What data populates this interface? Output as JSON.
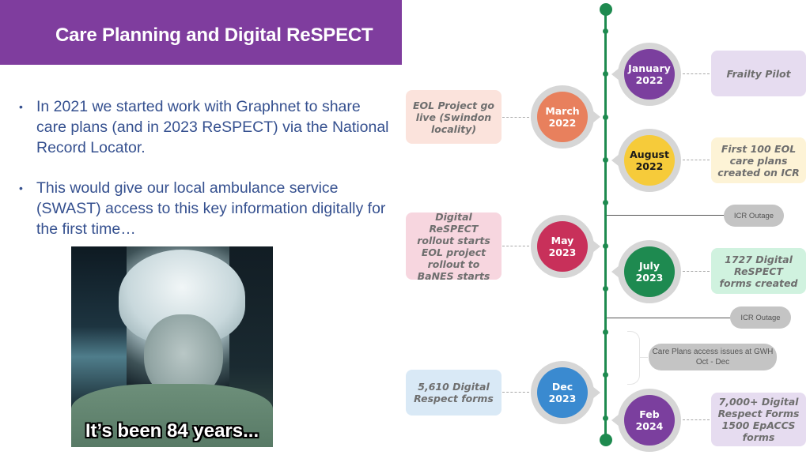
{
  "slide": {
    "title": "Care Planning and Digital ReSPECT",
    "bullets": [
      "In 2021 we started work with Graphnet to share care plans (and in 2023 ReSPECT) via the National Record Locator.",
      "This would give our local ambulance service (SWAST) access to this key information digitally for the first time…"
    ],
    "bullet_glyph": "•",
    "meme": {
      "caption": "It’s been 84 years..."
    }
  },
  "timeline": {
    "line_color": "#1e8a4f",
    "milestones": [
      {
        "id": "jan-2022",
        "month": "January",
        "year": "2022",
        "side": "right",
        "color": "#7b3f9e",
        "text_color": "#ffffff",
        "note": "Frailty Pilot",
        "note_bg": "#e6dcf0"
      },
      {
        "id": "mar-2022",
        "month": "March",
        "year": "2022",
        "side": "left",
        "color": "#e8805d",
        "text_color": "#ffffff",
        "note": "EOL Project go live (Swindon locality)",
        "note_bg": "#fbe3dc"
      },
      {
        "id": "aug-2022",
        "month": "August",
        "year": "2022",
        "side": "right",
        "color": "#f6cb3a",
        "text_color": "#1a1a1a",
        "note": "First 100 EOL care plans created on ICR",
        "note_bg": "#fdf3d6"
      },
      {
        "id": "may-2023",
        "month": "May",
        "year": "2023",
        "side": "left",
        "color": "#c8305a",
        "text_color": "#ffffff",
        "note": "Digital ReSPECT rollout starts EOL project rollout to BaNES starts",
        "note_bg": "#f7d6df"
      },
      {
        "id": "jul-2023",
        "month": "July",
        "year": "2023",
        "side": "right",
        "color": "#1e8a50",
        "text_color": "#ffffff",
        "note": "1727 Digital ReSPECT forms created",
        "note_bg": "#d0f2df"
      },
      {
        "id": "dec-2023",
        "month": "Dec",
        "year": "2023",
        "side": "left",
        "color": "#3a8ad0",
        "text_color": "#ffffff",
        "note": "5,610 Digital Respect forms",
        "note_bg": "#d9e9f6"
      },
      {
        "id": "feb-2024",
        "month": "Feb",
        "year": "2024",
        "side": "right",
        "color": "#7b3f9e",
        "text_color": "#ffffff",
        "note": "7,000+ Digital Respect Forms 1500 EpACCS forms",
        "note_bg": "#e6dcf0"
      }
    ],
    "events": [
      {
        "id": "outage-1",
        "label": "ICR Outage"
      },
      {
        "id": "outage-2",
        "label": "ICR Outage"
      },
      {
        "id": "gwh-issues",
        "label": "Care Plans access issues at GWH",
        "sublabel": "Oct - Dec"
      }
    ]
  }
}
